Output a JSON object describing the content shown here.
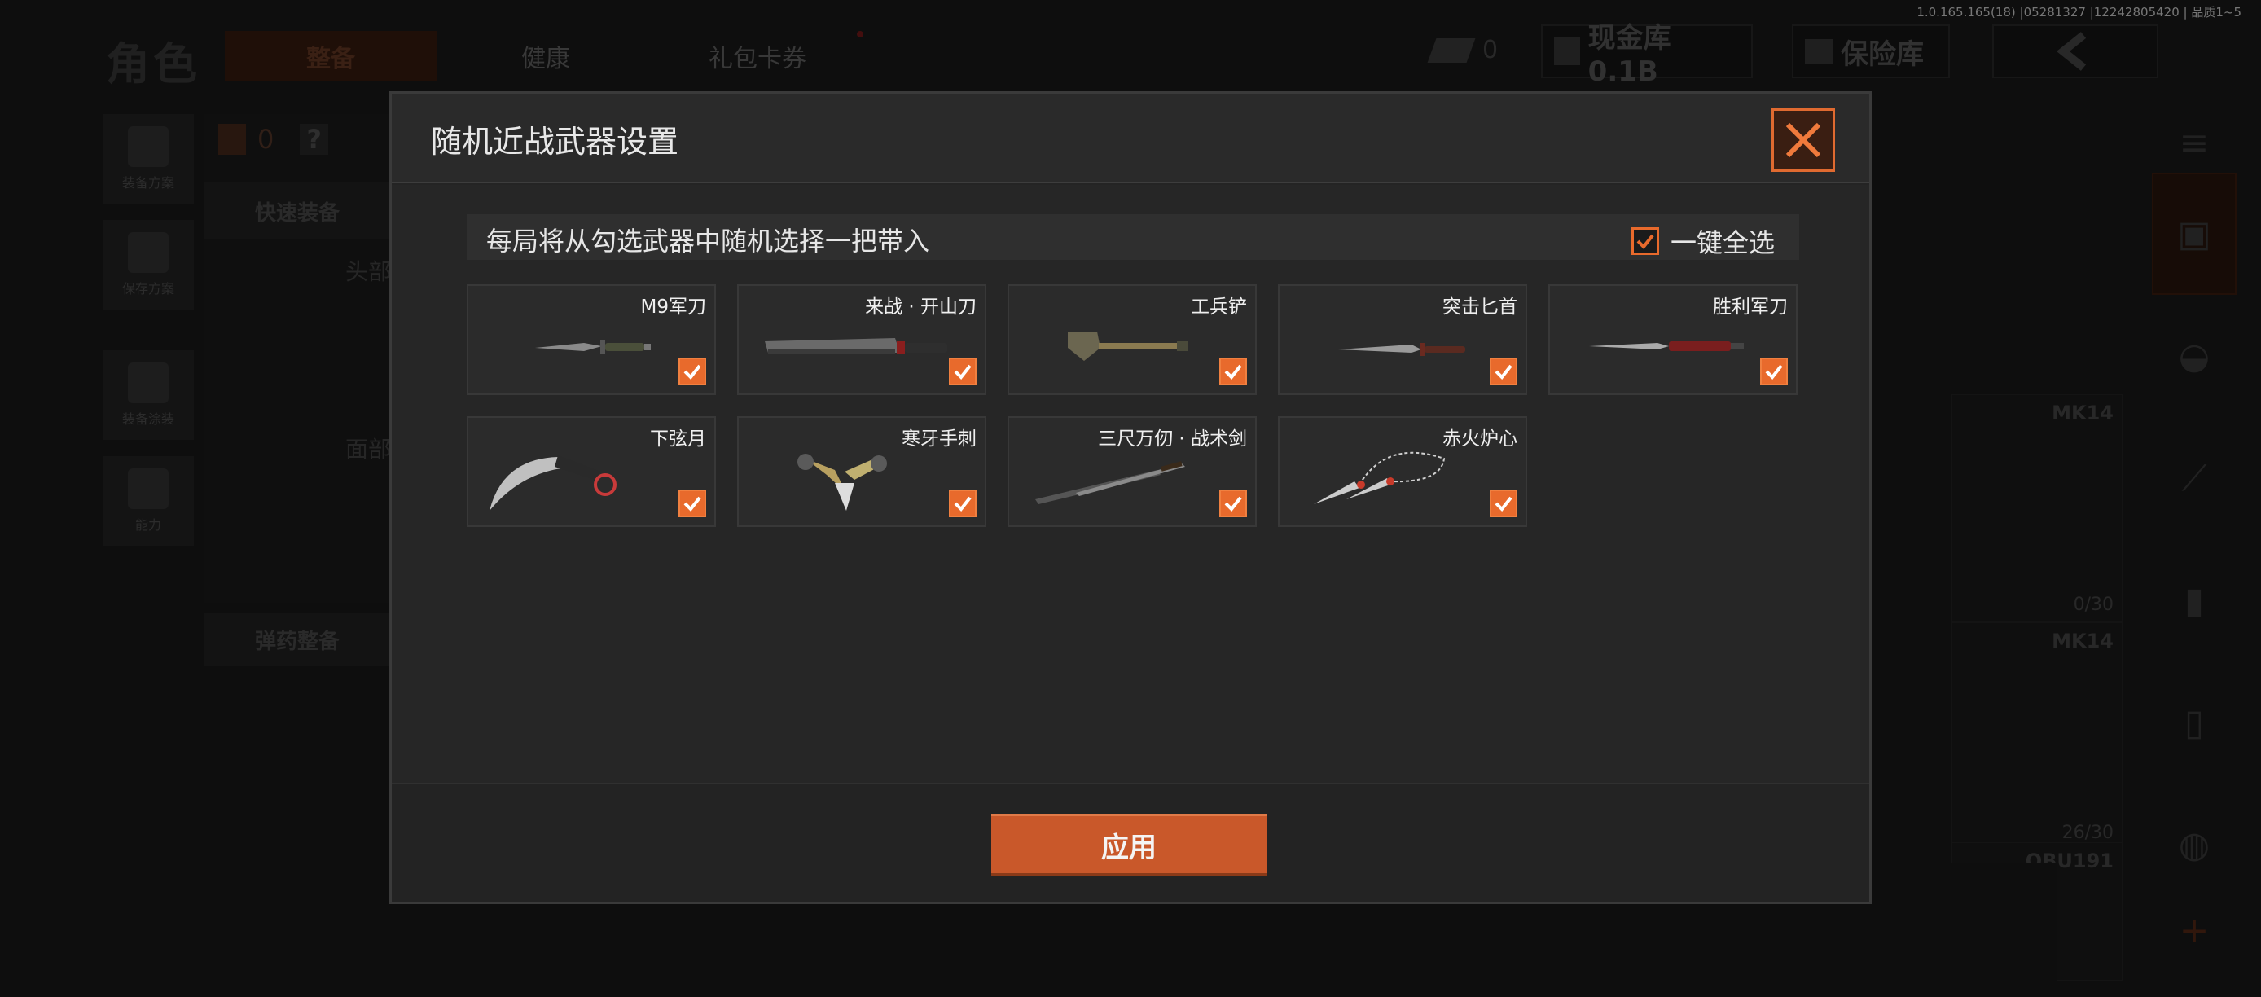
{
  "build_info": "1.0.165.165(18) |05281327 |12242805420 | 品质1~5",
  "background": {
    "page_title": "角色",
    "tabs": [
      "整备",
      "健康",
      "礼包卡券"
    ],
    "coins": "0",
    "cash_vault": "现金库 0.1B",
    "safe": "保险库",
    "left_buttons": [
      "装备方案",
      "保存方案",
      "装备涂装",
      "能力"
    ],
    "backpack_count": "0",
    "help": "?",
    "quick_equip": "快速装备",
    "head_label": "头部",
    "face_label": "面部",
    "ammo_label": "弹药整备",
    "weapon_cards": [
      {
        "name": "MK14",
        "count": "0/30"
      },
      {
        "name": "MK14",
        "count": "26/30"
      },
      {
        "name": "QBU191",
        "count": ""
      }
    ]
  },
  "modal": {
    "title": "随机近战武器设置",
    "info": "每局将从勾选武器中随机选择一把带入",
    "select_all_label": "一键全选",
    "select_all_checked": true,
    "weapons": [
      {
        "name": "M9军刀",
        "checked": true
      },
      {
        "name": "来战 · 开山刀",
        "checked": true
      },
      {
        "name": "工兵铲",
        "checked": true
      },
      {
        "name": "突击匕首",
        "checked": true
      },
      {
        "name": "胜利军刀",
        "checked": true
      },
      {
        "name": "下弦月",
        "checked": true
      },
      {
        "name": "寒牙手刺",
        "checked": true
      },
      {
        "name": "三尺万仞 · 战术剑",
        "checked": true
      },
      {
        "name": "赤火炉心",
        "checked": true
      }
    ],
    "apply_label": "应用"
  },
  "colors": {
    "accent": "#e86a2c",
    "apply": "#c9582a",
    "modal_bg": "#242424"
  }
}
